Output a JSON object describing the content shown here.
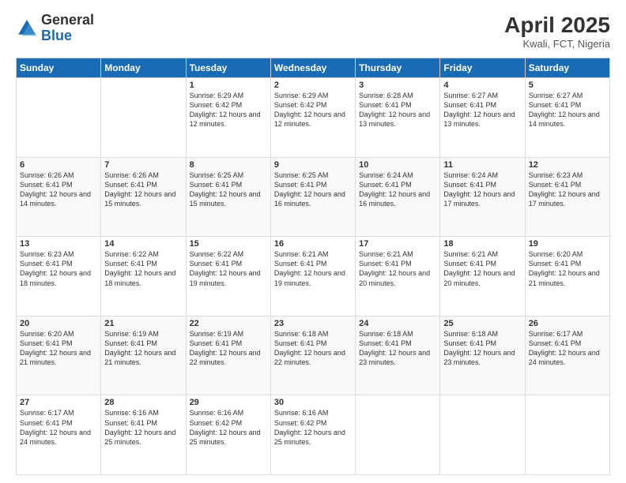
{
  "header": {
    "logo": {
      "general": "General",
      "blue": "Blue"
    },
    "title": "April 2025",
    "location": "Kwali, FCT, Nigeria"
  },
  "calendar": {
    "days_of_week": [
      "Sunday",
      "Monday",
      "Tuesday",
      "Wednesday",
      "Thursday",
      "Friday",
      "Saturday"
    ],
    "weeks": [
      [
        {
          "day": "",
          "info": ""
        },
        {
          "day": "",
          "info": ""
        },
        {
          "day": "1",
          "info": "Sunrise: 6:29 AM\nSunset: 6:42 PM\nDaylight: 12 hours and 12 minutes."
        },
        {
          "day": "2",
          "info": "Sunrise: 6:29 AM\nSunset: 6:42 PM\nDaylight: 12 hours and 12 minutes."
        },
        {
          "day": "3",
          "info": "Sunrise: 6:28 AM\nSunset: 6:41 PM\nDaylight: 12 hours and 13 minutes."
        },
        {
          "day": "4",
          "info": "Sunrise: 6:27 AM\nSunset: 6:41 PM\nDaylight: 12 hours and 13 minutes."
        },
        {
          "day": "5",
          "info": "Sunrise: 6:27 AM\nSunset: 6:41 PM\nDaylight: 12 hours and 14 minutes."
        }
      ],
      [
        {
          "day": "6",
          "info": "Sunrise: 6:26 AM\nSunset: 6:41 PM\nDaylight: 12 hours and 14 minutes."
        },
        {
          "day": "7",
          "info": "Sunrise: 6:26 AM\nSunset: 6:41 PM\nDaylight: 12 hours and 15 minutes."
        },
        {
          "day": "8",
          "info": "Sunrise: 6:25 AM\nSunset: 6:41 PM\nDaylight: 12 hours and 15 minutes."
        },
        {
          "day": "9",
          "info": "Sunrise: 6:25 AM\nSunset: 6:41 PM\nDaylight: 12 hours and 16 minutes."
        },
        {
          "day": "10",
          "info": "Sunrise: 6:24 AM\nSunset: 6:41 PM\nDaylight: 12 hours and 16 minutes."
        },
        {
          "day": "11",
          "info": "Sunrise: 6:24 AM\nSunset: 6:41 PM\nDaylight: 12 hours and 17 minutes."
        },
        {
          "day": "12",
          "info": "Sunrise: 6:23 AM\nSunset: 6:41 PM\nDaylight: 12 hours and 17 minutes."
        }
      ],
      [
        {
          "day": "13",
          "info": "Sunrise: 6:23 AM\nSunset: 6:41 PM\nDaylight: 12 hours and 18 minutes."
        },
        {
          "day": "14",
          "info": "Sunrise: 6:22 AM\nSunset: 6:41 PM\nDaylight: 12 hours and 18 minutes."
        },
        {
          "day": "15",
          "info": "Sunrise: 6:22 AM\nSunset: 6:41 PM\nDaylight: 12 hours and 19 minutes."
        },
        {
          "day": "16",
          "info": "Sunrise: 6:21 AM\nSunset: 6:41 PM\nDaylight: 12 hours and 19 minutes."
        },
        {
          "day": "17",
          "info": "Sunrise: 6:21 AM\nSunset: 6:41 PM\nDaylight: 12 hours and 20 minutes."
        },
        {
          "day": "18",
          "info": "Sunrise: 6:21 AM\nSunset: 6:41 PM\nDaylight: 12 hours and 20 minutes."
        },
        {
          "day": "19",
          "info": "Sunrise: 6:20 AM\nSunset: 6:41 PM\nDaylight: 12 hours and 21 minutes."
        }
      ],
      [
        {
          "day": "20",
          "info": "Sunrise: 6:20 AM\nSunset: 6:41 PM\nDaylight: 12 hours and 21 minutes."
        },
        {
          "day": "21",
          "info": "Sunrise: 6:19 AM\nSunset: 6:41 PM\nDaylight: 12 hours and 21 minutes."
        },
        {
          "day": "22",
          "info": "Sunrise: 6:19 AM\nSunset: 6:41 PM\nDaylight: 12 hours and 22 minutes."
        },
        {
          "day": "23",
          "info": "Sunrise: 6:18 AM\nSunset: 6:41 PM\nDaylight: 12 hours and 22 minutes."
        },
        {
          "day": "24",
          "info": "Sunrise: 6:18 AM\nSunset: 6:41 PM\nDaylight: 12 hours and 23 minutes."
        },
        {
          "day": "25",
          "info": "Sunrise: 6:18 AM\nSunset: 6:41 PM\nDaylight: 12 hours and 23 minutes."
        },
        {
          "day": "26",
          "info": "Sunrise: 6:17 AM\nSunset: 6:41 PM\nDaylight: 12 hours and 24 minutes."
        }
      ],
      [
        {
          "day": "27",
          "info": "Sunrise: 6:17 AM\nSunset: 6:41 PM\nDaylight: 12 hours and 24 minutes."
        },
        {
          "day": "28",
          "info": "Sunrise: 6:16 AM\nSunset: 6:41 PM\nDaylight: 12 hours and 25 minutes."
        },
        {
          "day": "29",
          "info": "Sunrise: 6:16 AM\nSunset: 6:42 PM\nDaylight: 12 hours and 25 minutes."
        },
        {
          "day": "30",
          "info": "Sunrise: 6:16 AM\nSunset: 6:42 PM\nDaylight: 12 hours and 25 minutes."
        },
        {
          "day": "",
          "info": ""
        },
        {
          "day": "",
          "info": ""
        },
        {
          "day": "",
          "info": ""
        }
      ]
    ]
  }
}
